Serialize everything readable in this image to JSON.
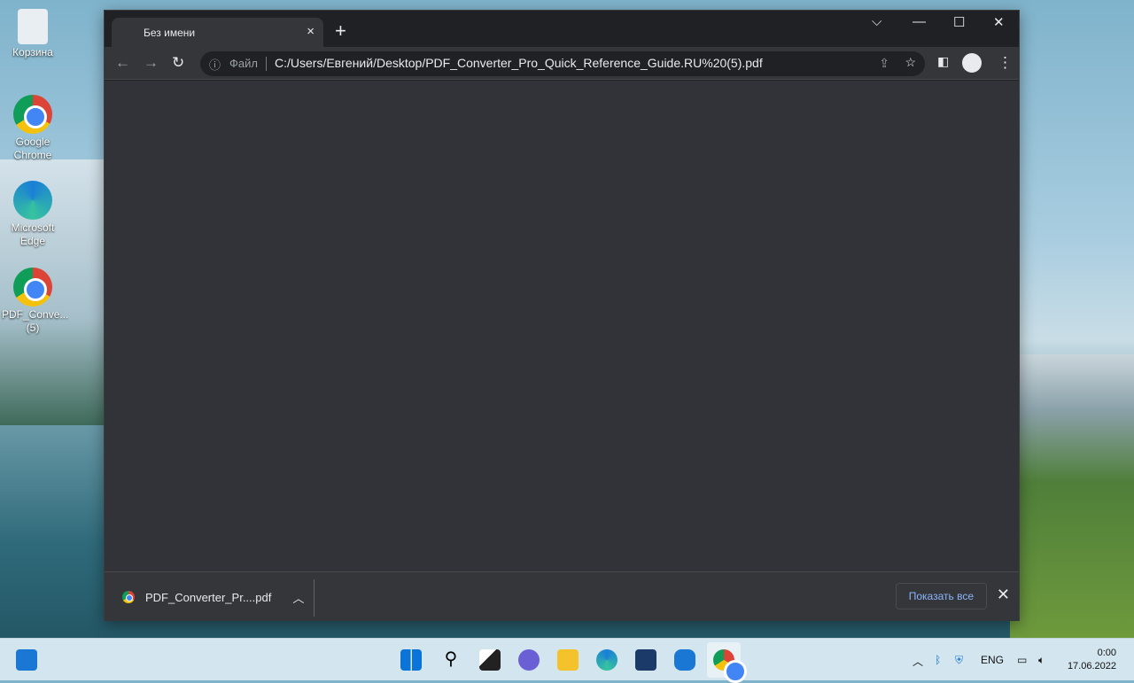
{
  "desktop": {
    "icons": [
      {
        "label": "Корзина",
        "icon": "recycle-bin-icon"
      },
      {
        "label": "Google Chrome",
        "icon": "chrome-icon"
      },
      {
        "label": "Microsoft Edge",
        "icon": "edge-icon"
      },
      {
        "label": "PDF_Conve... (5)",
        "icon": "chrome-icon"
      }
    ]
  },
  "browser": {
    "tab_title": "Без имени",
    "close_tab": "×",
    "new_tab": "+",
    "minimize": "—",
    "maximize": "☐",
    "close": "✕",
    "tab_search": "⌵",
    "omnibox": {
      "info_icon": "ⓘ",
      "scheme": "Файл",
      "url": "C:/Users/Евгений/Desktop/PDF_Converter_Pro_Quick_Reference_Guide.RU%20(5).pdf"
    },
    "download": {
      "file": "PDF_Converter_Pr....pdf",
      "show_all": "Показать все",
      "close": "✕"
    }
  },
  "taskbar": {
    "language": "ENG",
    "time": "0:00",
    "date": "17.06.2022",
    "colors": {
      "background": "#d3e5ee"
    }
  }
}
